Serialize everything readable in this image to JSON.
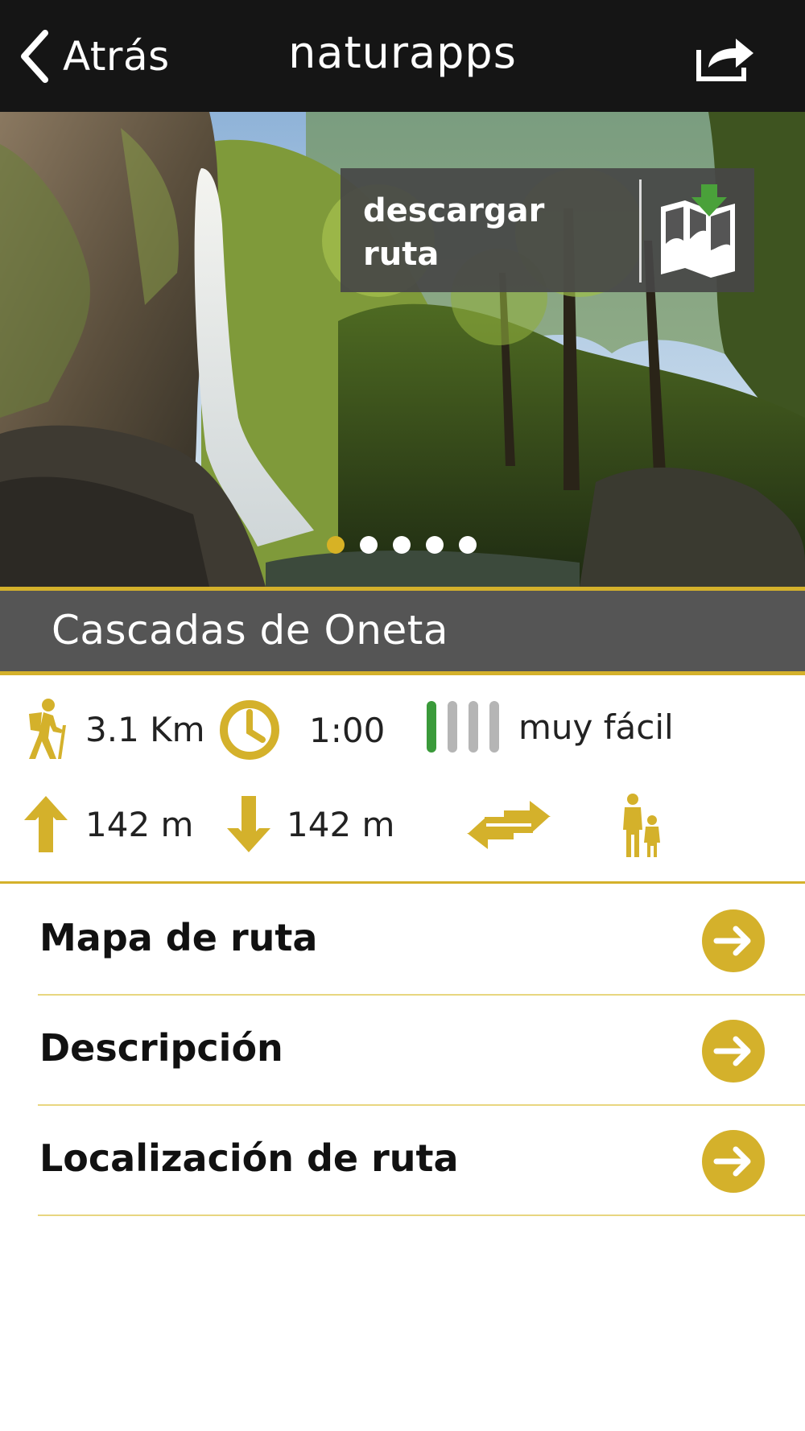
{
  "header": {
    "back_label": "Atrás",
    "title": "naturapps"
  },
  "hero": {
    "download_label_line1": "descargar",
    "download_label_line2": "ruta",
    "carousel": {
      "total": 5,
      "active_index": 0
    }
  },
  "route": {
    "name": "Cascadas de Oneta"
  },
  "stats": {
    "distance": "3.1 Km",
    "duration": "1:00",
    "difficulty": "muy fácil",
    "difficulty_level": 1,
    "difficulty_max": 4,
    "ascent": "142 m",
    "descent": "142 m"
  },
  "menu": [
    {
      "label": "Mapa de ruta"
    },
    {
      "label": "Descripción"
    },
    {
      "label": "Localización de ruta"
    }
  ],
  "colors": {
    "accent": "#d4b12b",
    "header_bg": "#151515",
    "band_bg": "#555555",
    "difficulty_on": "#3a9a3a",
    "difficulty_off": "#b5b5b5",
    "download_arrow": "#4aa13a"
  }
}
